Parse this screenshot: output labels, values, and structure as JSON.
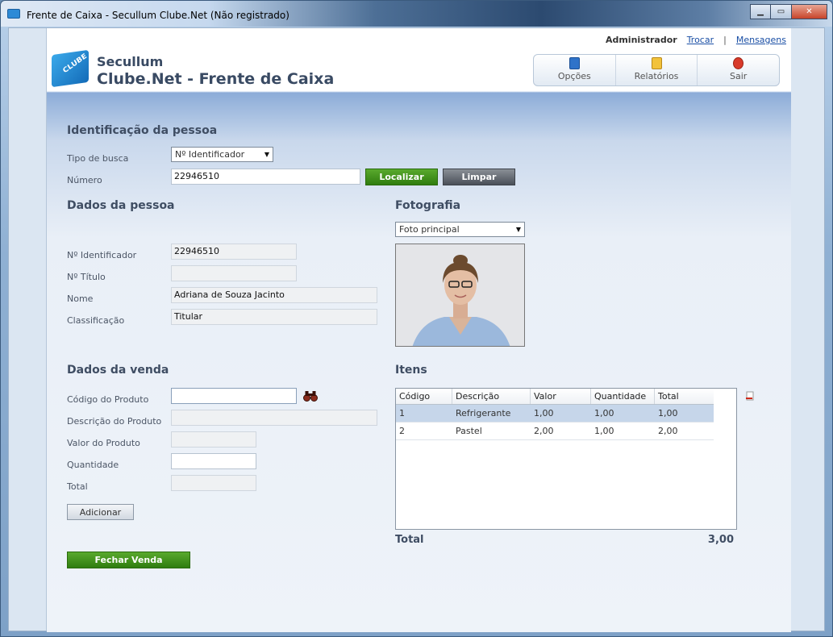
{
  "window": {
    "title": "Frente de Caixa - Secullum Clube.Net (Não registrado)"
  },
  "userbar": {
    "user": "Administrador",
    "switch_link": "Trocar",
    "separator": "|",
    "messages_link": "Mensagens"
  },
  "header": {
    "brand_line1": "Secullum",
    "brand_line2": "Clube.Net - Frente de Caixa",
    "logo_text": "CLUBE"
  },
  "toolbar": {
    "options": "Opções",
    "reports": "Relatórios",
    "exit": "Sair"
  },
  "identificacao": {
    "title": "Identificação da pessoa",
    "search_type_label": "Tipo de busca",
    "search_type_value": "Nº Identificador",
    "number_label": "Número",
    "number_value": "22946510",
    "locate_button": "Localizar",
    "clear_button": "Limpar"
  },
  "pessoa": {
    "title": "Dados da pessoa",
    "id_label": "Nº Identificador",
    "id_value": "22946510",
    "titulo_label": "Nº Título",
    "titulo_value": "",
    "nome_label": "Nome",
    "nome_value": "Adriana de Souza Jacinto",
    "classificacao_label": "Classificação",
    "classificacao_value": "Titular"
  },
  "fotografia": {
    "title": "Fotografia",
    "photo_select": "Foto principal"
  },
  "venda": {
    "title": "Dados da venda",
    "codigo_label": "Código do Produto",
    "codigo_value": "",
    "descricao_label": "Descrição do Produto",
    "descricao_value": "",
    "valor_label": "Valor do Produto",
    "valor_value": "",
    "quantidade_label": "Quantidade",
    "quantidade_value": "",
    "total_label": "Total",
    "total_value": "",
    "add_button": "Adicionar",
    "close_sale_button": "Fechar Venda"
  },
  "itens": {
    "title": "Itens",
    "columns": [
      "Código",
      "Descrição",
      "Valor",
      "Quantidade",
      "Total"
    ],
    "rows": [
      [
        "1",
        "Refrigerante",
        "1,00",
        "1,00",
        "1,00"
      ],
      [
        "2",
        "Pastel",
        "2,00",
        "1,00",
        "2,00"
      ]
    ],
    "total_label": "Total",
    "total_value": "3,00"
  }
}
